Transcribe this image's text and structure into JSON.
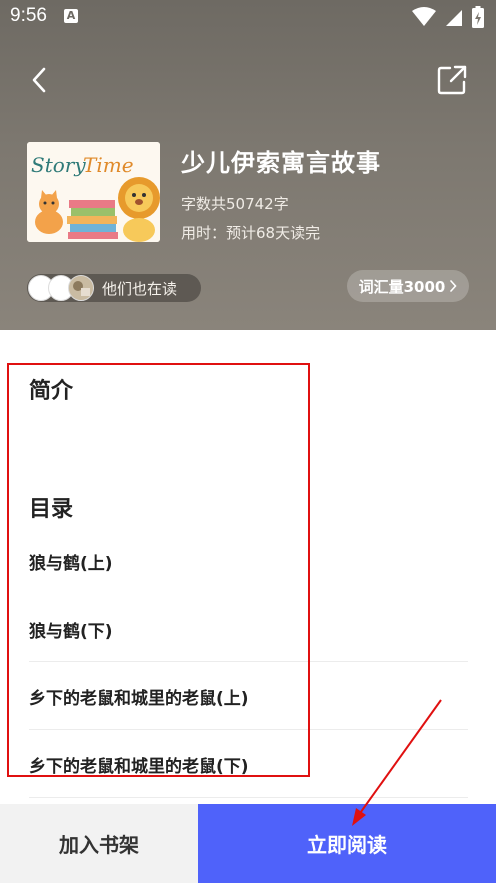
{
  "status_bar": {
    "time": "9:56",
    "notification_icon": "A",
    "icons": [
      "wifi-icon",
      "signal-icon",
      "battery-charging-icon"
    ]
  },
  "header": {
    "back_icon": "chevron-left-icon",
    "share_icon": "external-link-icon",
    "cover_text": "Story Time",
    "title": "少儿伊索寓言故事",
    "word_count": "字数共50742字",
    "reading_time": "用时：预计68天读完",
    "readers_label": "他们也在读",
    "vocab_label": "词汇量3000",
    "vocab_icon": "chevron-right-icon"
  },
  "intro": {
    "heading": "简介"
  },
  "toc": {
    "heading": "目录",
    "chapters": [
      "狼与鹤(上)",
      "狼与鹤(下)",
      "乡下的老鼠和城里的老鼠(上)",
      "乡下的老鼠和城里的老鼠(下)"
    ]
  },
  "bottom_bar": {
    "add_to_shelf": "加入书架",
    "read_now": "立即阅读"
  },
  "colors": {
    "header_bg": "#7a756d",
    "primary_button": "#4f62fa",
    "annotation_red": "#e01010"
  }
}
